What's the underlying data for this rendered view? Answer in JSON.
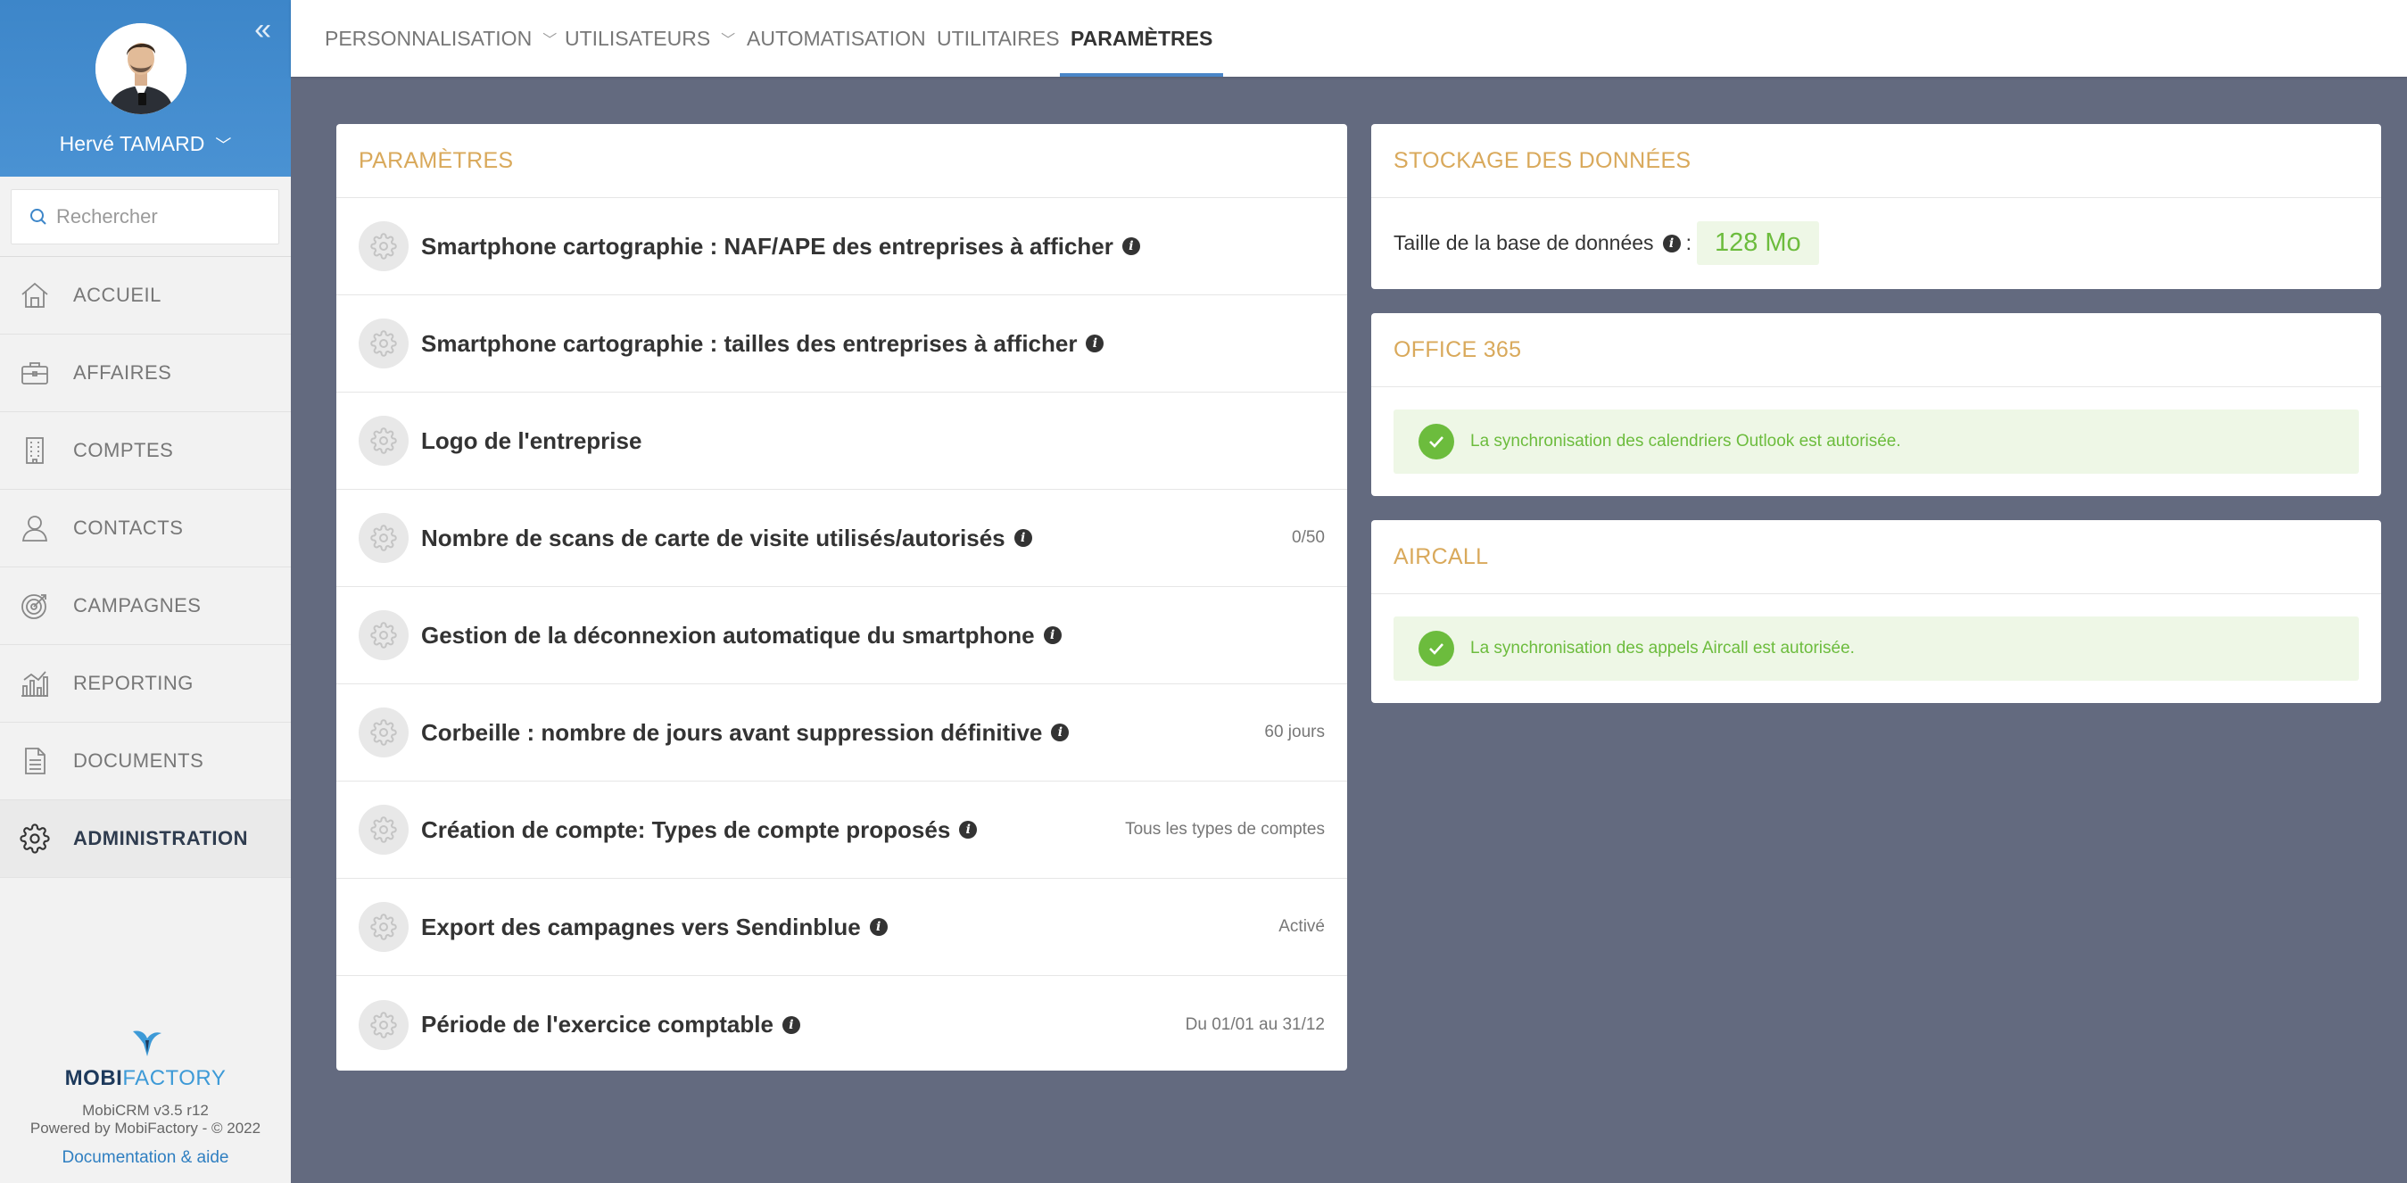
{
  "sidebar": {
    "user_name": "Hervé TAMARD",
    "search_placeholder": "Rechercher",
    "items": [
      {
        "label": "ACCUEIL",
        "icon": "home-icon"
      },
      {
        "label": "AFFAIRES",
        "icon": "briefcase-icon"
      },
      {
        "label": "COMPTES",
        "icon": "building-icon"
      },
      {
        "label": "CONTACTS",
        "icon": "person-icon"
      },
      {
        "label": "CAMPAGNES",
        "icon": "target-icon"
      },
      {
        "label": "REPORTING",
        "icon": "chart-icon"
      },
      {
        "label": "DOCUMENTS",
        "icon": "document-icon"
      },
      {
        "label": "ADMINISTRATION",
        "icon": "gear-icon",
        "active": true
      }
    ],
    "footer": {
      "brand_part1": "MOBI",
      "brand_part2": "FACTORY",
      "version": "MobiCRM v3.5 r12",
      "powered": "Powered by MobiFactory - © 2022",
      "doc_link": "Documentation & aide"
    }
  },
  "topbar": {
    "tabs": [
      {
        "label": "PERSONNALISATION",
        "dropdown": true
      },
      {
        "label": "UTILISATEURS",
        "dropdown": true
      },
      {
        "label": "AUTOMATISATION",
        "dropdown": false
      },
      {
        "label": "UTILITAIRES",
        "dropdown": false
      },
      {
        "label": "PARAMÈTRES",
        "dropdown": false,
        "active": true
      }
    ]
  },
  "parametres": {
    "title": "PARAMÈTRES",
    "rows": [
      {
        "label": "Smartphone cartographie : NAF/APE des entreprises à afficher",
        "info": true,
        "value": ""
      },
      {
        "label": "Smartphone cartographie : tailles des entreprises à afficher",
        "info": true,
        "value": ""
      },
      {
        "label": "Logo de l'entreprise",
        "info": false,
        "value": ""
      },
      {
        "label": "Nombre de scans de carte de visite utilisés/autorisés",
        "info": true,
        "value": "0/50"
      },
      {
        "label": "Gestion de la déconnexion automatique du smartphone",
        "info": true,
        "value": ""
      },
      {
        "label": "Corbeille : nombre de jours avant suppression définitive",
        "info": true,
        "value": "60 jours"
      },
      {
        "label": "Création de compte: Types de compte proposés",
        "info": true,
        "value": "Tous les types de comptes"
      },
      {
        "label": "Export des campagnes vers Sendinblue",
        "info": true,
        "value": "Activé"
      },
      {
        "label": "Période de l'exercice comptable",
        "info": true,
        "value": "Du 01/01 au 31/12"
      }
    ]
  },
  "storage": {
    "title": "STOCKAGE DES DONNÉES",
    "label": "Taille de la base de données",
    "colon": ":",
    "value": "128 Mo"
  },
  "office": {
    "title": "OFFICE 365",
    "message": "La synchronisation des calendriers Outlook est autorisée."
  },
  "aircall": {
    "title": "AIRCALL",
    "message": "La synchronisation des appels Aircall est autorisée."
  },
  "colors": {
    "accent_blue": "#4a86c8",
    "title_gold": "#d9a95b",
    "success_green": "#6cbc3d",
    "background": "#636a7f"
  }
}
